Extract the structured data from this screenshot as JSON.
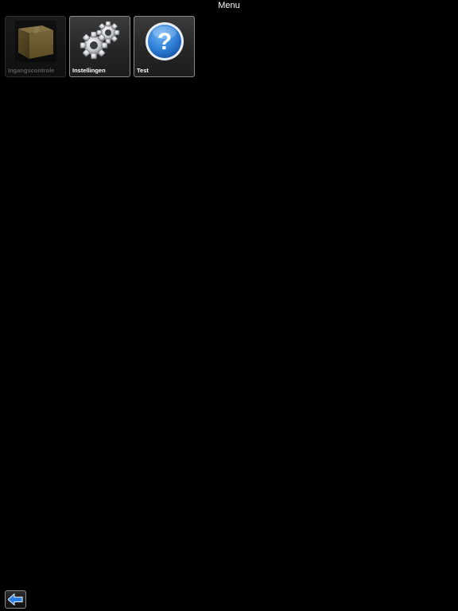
{
  "header": {
    "title": "Menu"
  },
  "tiles": [
    {
      "label": "Ingangscontrole",
      "icon": "box-icon",
      "enabled": false
    },
    {
      "label": "Instellingen",
      "icon": "gears-icon",
      "enabled": true
    },
    {
      "label": "Test",
      "icon": "help-icon",
      "enabled": true
    }
  ],
  "footer": {
    "back_icon": "back-arrow-icon"
  },
  "colors": {
    "background": "#000000",
    "tile_border": "#8a8a8a",
    "help_blue": "#2f7fd6",
    "box_tan": "#a38a4a",
    "arrow_blue": "#2a7fe0"
  }
}
